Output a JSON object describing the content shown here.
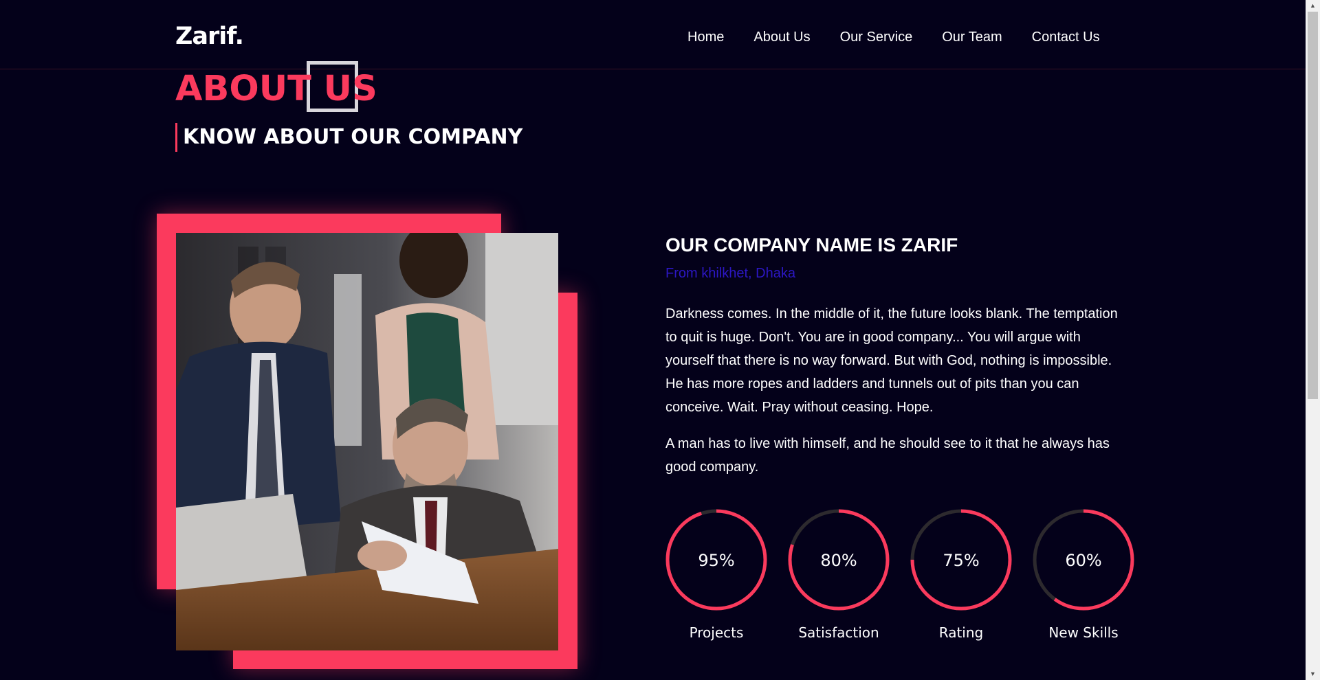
{
  "header": {
    "logo": "Zarif.",
    "nav": [
      "Home",
      "About Us",
      "Our Service",
      "Our Team",
      "Contact Us"
    ]
  },
  "section": {
    "title": "ABOUT US",
    "subtitle": "KNOW ABOUT OUR COMPANY"
  },
  "about": {
    "heading": "OUR COMPANY NAME IS ZARIF",
    "location": "From khilkhet, Dhaka",
    "paragraph1": "Darkness comes. In the middle of it, the future looks blank. The temptation to quit is huge. Don't. You are in good company... You will argue with yourself that there is no way forward. But with God, nothing is impossible. He has more ropes and ladders and tunnels out of pits than you can conceive. Wait. Pray without ceasing. Hope.",
    "paragraph2": "A man has to live with himself, and he should see to it that he always has good company."
  },
  "stats": [
    {
      "value": "95%",
      "percent": 95,
      "label": "Projects"
    },
    {
      "value": "80%",
      "percent": 80,
      "label": "Satisfaction"
    },
    {
      "value": "75%",
      "percent": 75,
      "label": "Rating"
    },
    {
      "value": "60%",
      "percent": 60,
      "label": "New Skills"
    }
  ],
  "colors": {
    "background": "#04011a",
    "accent": "#fb3a5d",
    "location": "#2c17c4",
    "ring_track": "#2d2a2e"
  }
}
